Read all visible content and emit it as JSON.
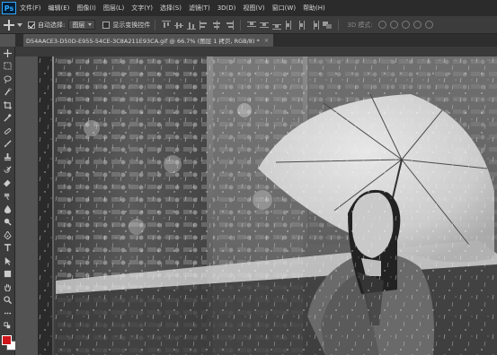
{
  "app": {
    "logo": "Ps"
  },
  "menubar": {
    "items": [
      "文件(F)",
      "编辑(E)",
      "图像(I)",
      "图层(L)",
      "文字(Y)",
      "选择(S)",
      "滤镜(T)",
      "3D(D)",
      "视图(V)",
      "窗口(W)",
      "帮助(H)"
    ]
  },
  "options": {
    "auto_select_label": "自动选择:",
    "auto_select_checked": true,
    "auto_select_value": "图层",
    "show_transform_label": "显示变换控件",
    "show_transform_checked": false,
    "mode_3d_label": "3D 模式:"
  },
  "document": {
    "tab_title": "D54AACE3-D50D-E955-54CE-3C8A211E93CA.gif @ 66.7% (图层 1 拷贝, RGB/8) *",
    "close_glyph": "×"
  },
  "tools": [
    "move-tool",
    "marquee-tool",
    "lasso-tool",
    "quick-select-tool",
    "crop-tool",
    "eyedropper-tool",
    "healing-tool",
    "brush-tool",
    "clone-stamp-tool",
    "history-brush-tool",
    "eraser-tool",
    "gradient-tool",
    "blur-tool",
    "dodge-tool",
    "pen-tool",
    "type-tool",
    "path-select-tool",
    "shape-tool",
    "hand-tool",
    "zoom-tool",
    "more-tools"
  ],
  "colors": {
    "foreground": "#d0141b",
    "background": "#ffffff"
  }
}
